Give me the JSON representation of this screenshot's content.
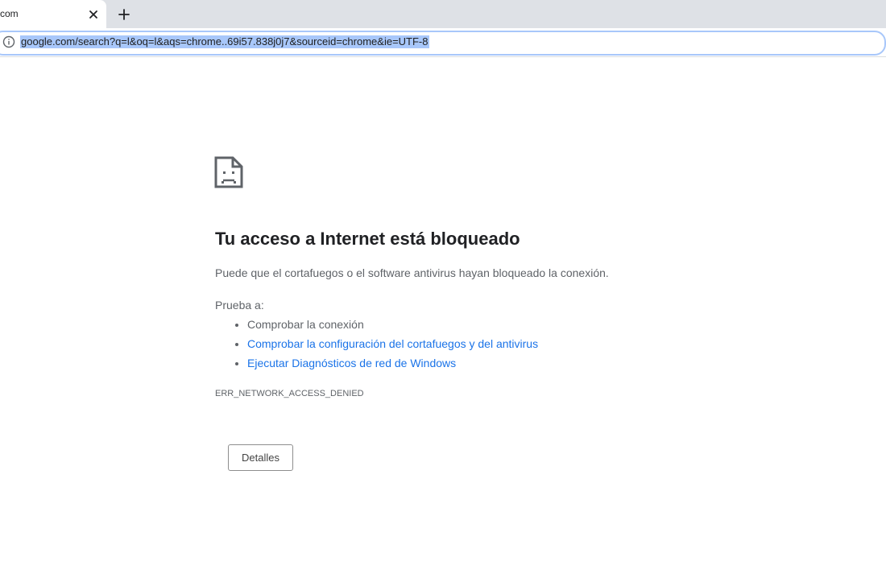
{
  "browser": {
    "tab": {
      "title": "com",
      "close_icon": "close-icon"
    },
    "new_tab_icon": "plus-icon",
    "address_bar": {
      "info_icon": "info-icon",
      "url": "google.com/search?q=l&oq=l&aqs=chrome..69i57.838j0j7&sourceid=chrome&ie=UTF-8",
      "selection_color": "#a8c7fa"
    }
  },
  "error_page": {
    "icon": "sad-page-icon",
    "heading": "Tu acceso a Internet está bloqueado",
    "description": "Puede que el cortafuegos o el software antivirus hayan bloqueado la conexión.",
    "try_label": "Prueba a:",
    "suggestions": [
      {
        "text": "Comprobar la conexión",
        "link": false
      },
      {
        "text": "Comprobar la configuración del cortafuegos y del antivirus",
        "link": true
      },
      {
        "text": "Ejecutar Diagnósticos de red de Windows",
        "link": true
      }
    ],
    "error_code": "ERR_NETWORK_ACCESS_DENIED",
    "details_button": "Detalles",
    "link_color": "#1a73e8",
    "text_color": "#5f6368"
  }
}
